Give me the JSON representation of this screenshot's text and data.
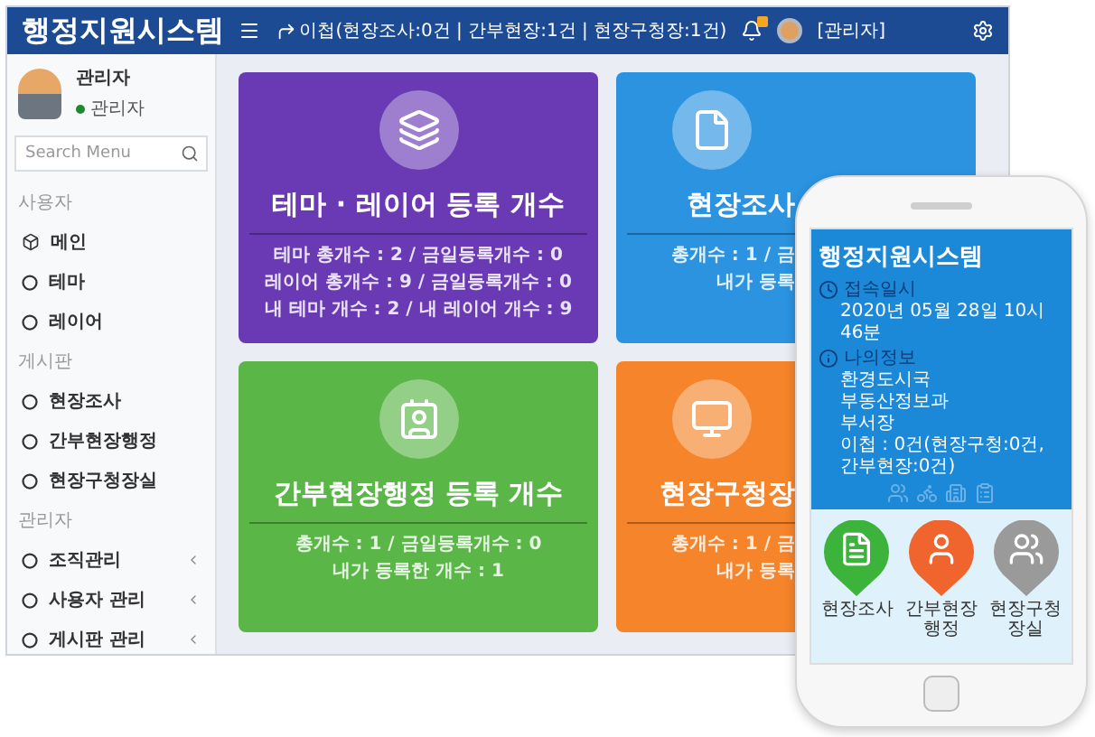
{
  "header": {
    "title": "행정지원시스템",
    "notice": "이첩(현장조사:0건 | 간부현장:1건 | 현장구청장:1건)",
    "user": "[관리자]"
  },
  "profile": {
    "name": "관리자",
    "role": "관리자"
  },
  "search": {
    "placeholder": "Search Menu"
  },
  "sidebar": {
    "sections": [
      {
        "title": "사용자",
        "items": [
          {
            "label": "메인",
            "kind": "home",
            "expandable": false
          },
          {
            "label": "테마",
            "kind": "item",
            "expandable": false
          },
          {
            "label": "레이어",
            "kind": "item",
            "expandable": false
          }
        ]
      },
      {
        "title": "게시판",
        "items": [
          {
            "label": "현장조사",
            "kind": "item",
            "expandable": false
          },
          {
            "label": "간부현장행정",
            "kind": "item",
            "expandable": false
          },
          {
            "label": "현장구청장실",
            "kind": "item",
            "expandable": false
          }
        ]
      },
      {
        "title": "관리자",
        "items": [
          {
            "label": "조직관리",
            "kind": "item",
            "expandable": true
          },
          {
            "label": "사용자 관리",
            "kind": "item",
            "expandable": true
          },
          {
            "label": "게시판 관리",
            "kind": "item",
            "expandable": true
          }
        ]
      }
    ]
  },
  "cards": [
    {
      "title": "테마 · 레이어 등록 개수",
      "color": "#6a3ab5",
      "kind": "layers",
      "lines": [
        "테마 총개수 : 2 / 금일등록개수 : 0",
        "레이어 총개수 : 9 / 금일등록개수 : 0",
        "내 테마 개수 : 2 / 내 레이어 개수 : 9"
      ]
    },
    {
      "title": "현장조사",
      "color": "#2b93e0",
      "kind": "document",
      "lines": [
        "총개수 : 1 / 금",
        "내가 등록"
      ]
    },
    {
      "title": "간부현장행정 등록 개수",
      "color": "#5ab646",
      "kind": "contact",
      "lines": [
        "총개수 : 1 / 금일등록개수 : 0",
        "내가 등록한 개수 : 1"
      ]
    },
    {
      "title": "현장구청장",
      "color": "#f5842a",
      "kind": "monitor",
      "lines": [
        "총개수 : 1 / 금",
        "내가 등록"
      ]
    }
  ],
  "phone": {
    "title": "행정지원시스템",
    "access_label": "접속일시",
    "access_time": "2020년 05월 28일 10시 46분",
    "info_label": "나의정보",
    "info_lines": [
      "환경도시국",
      "부동산정보과",
      "부서장",
      "이첩 : 0건(현장구청:0건, 간부현장:0건)"
    ],
    "pins": [
      {
        "label": "현장조사",
        "color": "#3cb43c",
        "kind": "document"
      },
      {
        "label": "간부현장행정",
        "color": "#f0642d",
        "kind": "person"
      },
      {
        "label": "현장구청장실",
        "color": "#9a9a9a",
        "kind": "group"
      }
    ]
  }
}
